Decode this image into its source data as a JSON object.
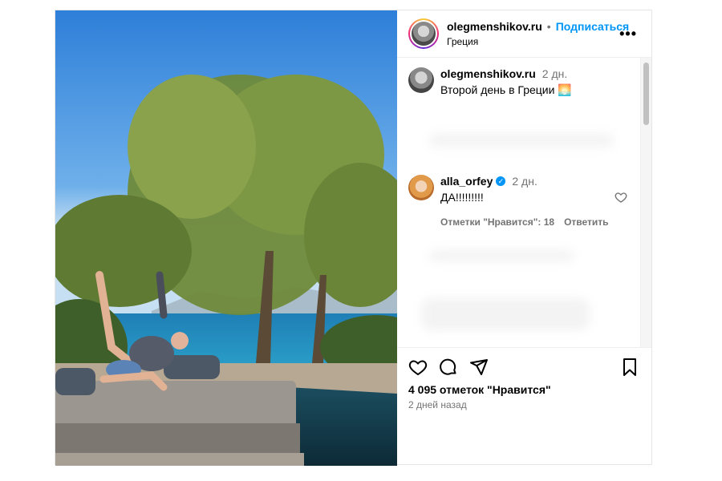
{
  "header": {
    "username": "olegmenshikov.ru",
    "dot": "•",
    "follow_label": "Подписаться",
    "location": "Греция",
    "more_label": "•••"
  },
  "caption": {
    "username": "olegmenshikov.ru",
    "time": "2 дн.",
    "text": "Второй день в Греции 🌅"
  },
  "comment": {
    "username": "alla_orfey",
    "verified_mark": "✓",
    "time": "2 дн.",
    "text": "ДА!!!!!!!!!",
    "likes_label": "Отметки \"Нравится\": 18",
    "reply_label": "Ответить"
  },
  "footer": {
    "likes_count": "4 095 отметок \"Нравится\"",
    "ago": "2 дней назад"
  },
  "colors": {
    "accent": "#0095f6",
    "muted": "#737373"
  },
  "icons": {
    "like": "heart-icon",
    "comment": "comment-icon",
    "share": "send-icon",
    "save": "bookmark-icon",
    "more": "more-icon",
    "comment_like": "heart-icon"
  }
}
